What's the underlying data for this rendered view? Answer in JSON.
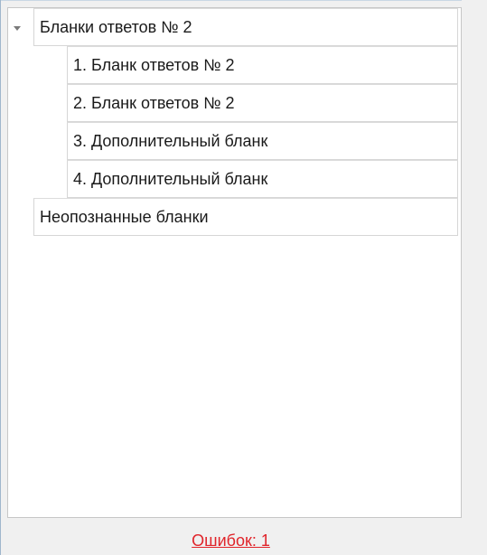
{
  "tree": {
    "root": {
      "label": "Бланки ответов № 2",
      "expanded": true,
      "children": [
        {
          "label": "1. Бланк ответов № 2"
        },
        {
          "label": "2. Бланк ответов № 2"
        },
        {
          "label": "3. Дополнительный бланк"
        },
        {
          "label": "4. Дополнительный бланк"
        }
      ]
    },
    "unrecognized": {
      "label": "Неопознанные бланки"
    }
  },
  "status": {
    "errors_label": "Ошибок: 1",
    "errors_color": "#e0242a"
  },
  "icons": {
    "expander": "chevron-down-icon"
  }
}
